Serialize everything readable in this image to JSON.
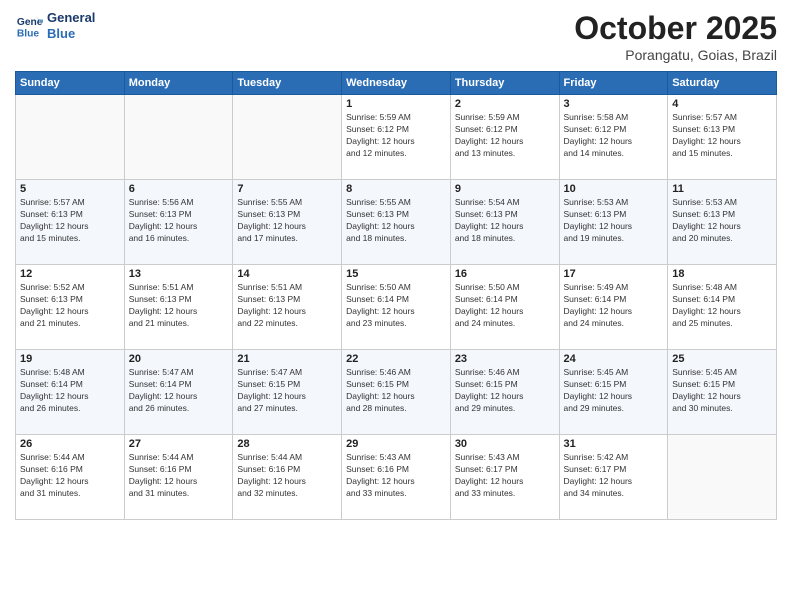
{
  "logo": {
    "line1": "General",
    "line2": "Blue"
  },
  "header": {
    "month": "October 2025",
    "location": "Porangatu, Goias, Brazil"
  },
  "weekdays": [
    "Sunday",
    "Monday",
    "Tuesday",
    "Wednesday",
    "Thursday",
    "Friday",
    "Saturday"
  ],
  "weeks": [
    [
      {
        "day": "",
        "text": ""
      },
      {
        "day": "",
        "text": ""
      },
      {
        "day": "",
        "text": ""
      },
      {
        "day": "1",
        "text": "Sunrise: 5:59 AM\nSunset: 6:12 PM\nDaylight: 12 hours\nand 12 minutes."
      },
      {
        "day": "2",
        "text": "Sunrise: 5:59 AM\nSunset: 6:12 PM\nDaylight: 12 hours\nand 13 minutes."
      },
      {
        "day": "3",
        "text": "Sunrise: 5:58 AM\nSunset: 6:12 PM\nDaylight: 12 hours\nand 14 minutes."
      },
      {
        "day": "4",
        "text": "Sunrise: 5:57 AM\nSunset: 6:13 PM\nDaylight: 12 hours\nand 15 minutes."
      }
    ],
    [
      {
        "day": "5",
        "text": "Sunrise: 5:57 AM\nSunset: 6:13 PM\nDaylight: 12 hours\nand 15 minutes."
      },
      {
        "day": "6",
        "text": "Sunrise: 5:56 AM\nSunset: 6:13 PM\nDaylight: 12 hours\nand 16 minutes."
      },
      {
        "day": "7",
        "text": "Sunrise: 5:55 AM\nSunset: 6:13 PM\nDaylight: 12 hours\nand 17 minutes."
      },
      {
        "day": "8",
        "text": "Sunrise: 5:55 AM\nSunset: 6:13 PM\nDaylight: 12 hours\nand 18 minutes."
      },
      {
        "day": "9",
        "text": "Sunrise: 5:54 AM\nSunset: 6:13 PM\nDaylight: 12 hours\nand 18 minutes."
      },
      {
        "day": "10",
        "text": "Sunrise: 5:53 AM\nSunset: 6:13 PM\nDaylight: 12 hours\nand 19 minutes."
      },
      {
        "day": "11",
        "text": "Sunrise: 5:53 AM\nSunset: 6:13 PM\nDaylight: 12 hours\nand 20 minutes."
      }
    ],
    [
      {
        "day": "12",
        "text": "Sunrise: 5:52 AM\nSunset: 6:13 PM\nDaylight: 12 hours\nand 21 minutes."
      },
      {
        "day": "13",
        "text": "Sunrise: 5:51 AM\nSunset: 6:13 PM\nDaylight: 12 hours\nand 21 minutes."
      },
      {
        "day": "14",
        "text": "Sunrise: 5:51 AM\nSunset: 6:13 PM\nDaylight: 12 hours\nand 22 minutes."
      },
      {
        "day": "15",
        "text": "Sunrise: 5:50 AM\nSunset: 6:14 PM\nDaylight: 12 hours\nand 23 minutes."
      },
      {
        "day": "16",
        "text": "Sunrise: 5:50 AM\nSunset: 6:14 PM\nDaylight: 12 hours\nand 24 minutes."
      },
      {
        "day": "17",
        "text": "Sunrise: 5:49 AM\nSunset: 6:14 PM\nDaylight: 12 hours\nand 24 minutes."
      },
      {
        "day": "18",
        "text": "Sunrise: 5:48 AM\nSunset: 6:14 PM\nDaylight: 12 hours\nand 25 minutes."
      }
    ],
    [
      {
        "day": "19",
        "text": "Sunrise: 5:48 AM\nSunset: 6:14 PM\nDaylight: 12 hours\nand 26 minutes."
      },
      {
        "day": "20",
        "text": "Sunrise: 5:47 AM\nSunset: 6:14 PM\nDaylight: 12 hours\nand 26 minutes."
      },
      {
        "day": "21",
        "text": "Sunrise: 5:47 AM\nSunset: 6:15 PM\nDaylight: 12 hours\nand 27 minutes."
      },
      {
        "day": "22",
        "text": "Sunrise: 5:46 AM\nSunset: 6:15 PM\nDaylight: 12 hours\nand 28 minutes."
      },
      {
        "day": "23",
        "text": "Sunrise: 5:46 AM\nSunset: 6:15 PM\nDaylight: 12 hours\nand 29 minutes."
      },
      {
        "day": "24",
        "text": "Sunrise: 5:45 AM\nSunset: 6:15 PM\nDaylight: 12 hours\nand 29 minutes."
      },
      {
        "day": "25",
        "text": "Sunrise: 5:45 AM\nSunset: 6:15 PM\nDaylight: 12 hours\nand 30 minutes."
      }
    ],
    [
      {
        "day": "26",
        "text": "Sunrise: 5:44 AM\nSunset: 6:16 PM\nDaylight: 12 hours\nand 31 minutes."
      },
      {
        "day": "27",
        "text": "Sunrise: 5:44 AM\nSunset: 6:16 PM\nDaylight: 12 hours\nand 31 minutes."
      },
      {
        "day": "28",
        "text": "Sunrise: 5:44 AM\nSunset: 6:16 PM\nDaylight: 12 hours\nand 32 minutes."
      },
      {
        "day": "29",
        "text": "Sunrise: 5:43 AM\nSunset: 6:16 PM\nDaylight: 12 hours\nand 33 minutes."
      },
      {
        "day": "30",
        "text": "Sunrise: 5:43 AM\nSunset: 6:17 PM\nDaylight: 12 hours\nand 33 minutes."
      },
      {
        "day": "31",
        "text": "Sunrise: 5:42 AM\nSunset: 6:17 PM\nDaylight: 12 hours\nand 34 minutes."
      },
      {
        "day": "",
        "text": ""
      }
    ]
  ]
}
